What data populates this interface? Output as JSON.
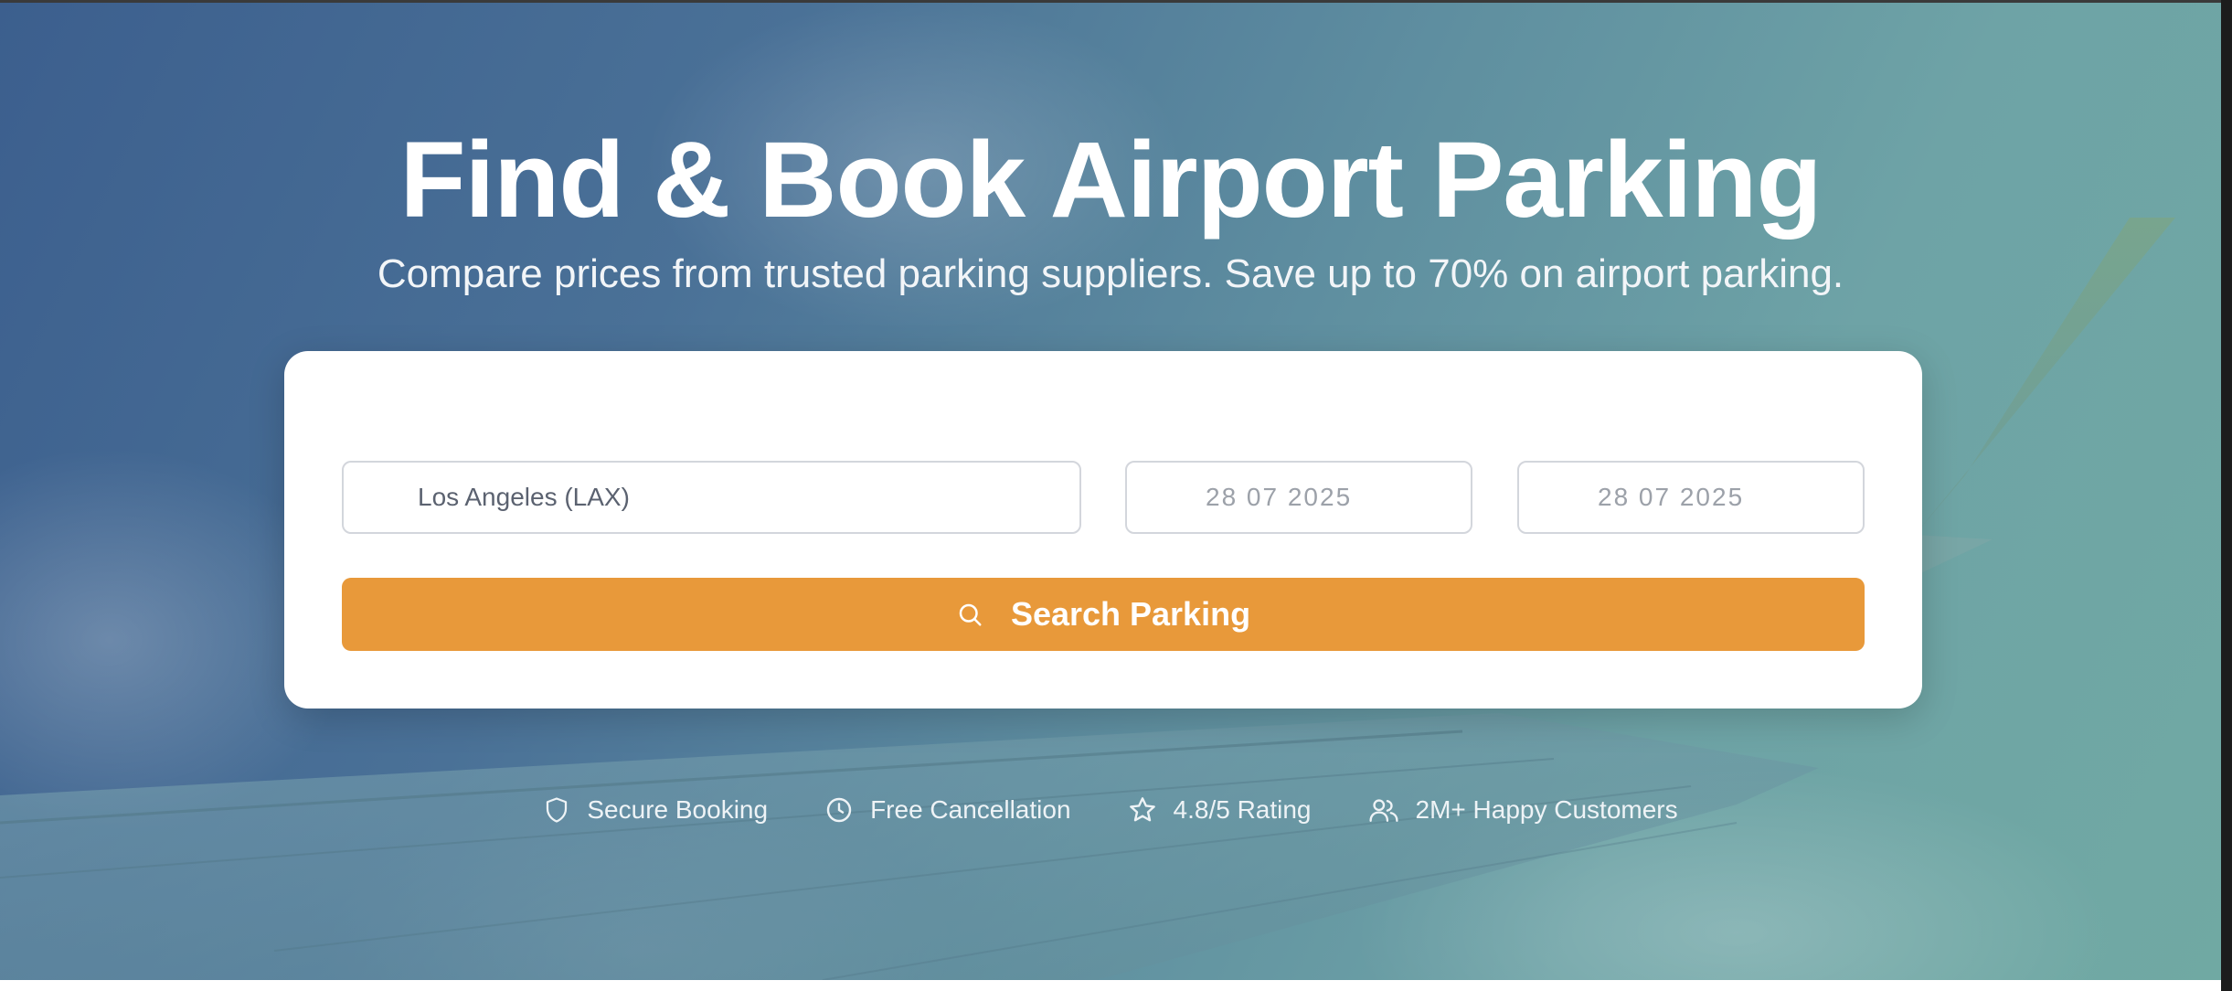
{
  "hero": {
    "title": "Find & Book Airport Parking",
    "subtitle": "Compare prices from trusted parking suppliers. Save up to 70% on airport parking."
  },
  "search_form": {
    "location_value": "Los Angeles (LAX)",
    "start_date_value": "28 07 2025",
    "end_date_value": "28 07 2025",
    "search_button_label": "Search Parking",
    "search_button_icon": "search-icon",
    "button_color": "#e8993a"
  },
  "features": [
    {
      "icon": "shield-icon",
      "label": "Secure Booking"
    },
    {
      "icon": "clock-icon",
      "label": "Free Cancellation"
    },
    {
      "icon": "star-icon",
      "label": "4.8/5 Rating"
    },
    {
      "icon": "users-icon",
      "label": "2M+ Happy Customers"
    }
  ]
}
